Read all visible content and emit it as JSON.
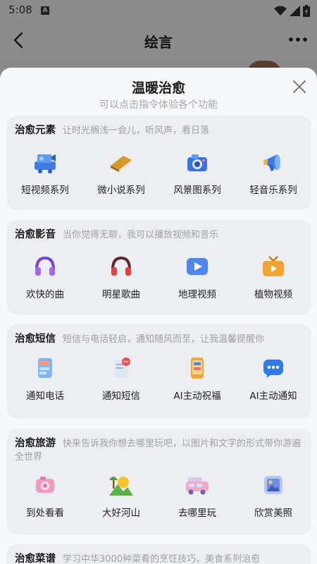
{
  "status_bar": {
    "time": "5:08",
    "notif_letter": "A"
  },
  "app_bar": {
    "title": "绘言"
  },
  "sheet": {
    "title": "温暖治愈",
    "subtitle": "可以点击指令体验各个功能",
    "sections": [
      {
        "title": "治愈元素",
        "desc": "让时光搁浅一会儿，听风声，看日落",
        "items": [
          {
            "label": "短视频系列",
            "icon": "video-camera-icon"
          },
          {
            "label": "微小说系列",
            "icon": "book-icon"
          },
          {
            "label": "风景图系列",
            "icon": "camera-icon"
          },
          {
            "label": "轻音乐系列",
            "icon": "megaphone-icon"
          }
        ]
      },
      {
        "title": "治愈影音",
        "desc": "当你觉得无聊，我可以播放视频和音乐",
        "items": [
          {
            "label": "欢快的曲",
            "icon": "headphones-purple-icon"
          },
          {
            "label": "明星歌曲",
            "icon": "headphones-red-icon"
          },
          {
            "label": "地理视频",
            "icon": "play-icon"
          },
          {
            "label": "植物视频",
            "icon": "tv-icon"
          }
        ]
      },
      {
        "title": "治愈短信",
        "desc": "短信与电话轻启，通知随风而至，让我温馨提醒你",
        "items": [
          {
            "label": "通知电话",
            "icon": "phone-icon"
          },
          {
            "label": "通知短信",
            "icon": "message-icon"
          },
          {
            "label": "AI主动祝福",
            "icon": "blessing-phone-icon"
          },
          {
            "label": "AI主动通知",
            "icon": "chat-bubble-icon"
          }
        ]
      },
      {
        "title": "治愈旅游",
        "desc": "快来告诉我你想去哪里玩吧，以图片和文字的形式带你游遍全世界",
        "items": [
          {
            "label": "到处看看",
            "icon": "pink-camera-icon"
          },
          {
            "label": "大好河山",
            "icon": "landscape-icon"
          },
          {
            "label": "去哪里玩",
            "icon": "camper-van-icon"
          },
          {
            "label": "欣赏美照",
            "icon": "photo-frame-icon"
          }
        ]
      },
      {
        "title": "治愈菜谱",
        "desc": "学习中华3000种菜肴的烹饪技巧，美食系列治愈",
        "items": []
      }
    ]
  }
}
